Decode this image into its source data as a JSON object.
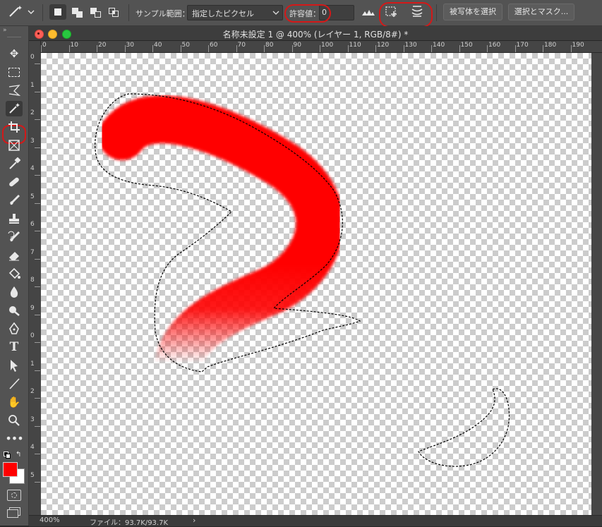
{
  "options_bar": {
    "sample_label": "サンプル範囲：",
    "sample_value": "指定したピクセル",
    "tolerance_label": "許容値：",
    "tolerance_value": "0",
    "select_subject": "被写体を選択",
    "select_and_mask": "選択とマスク..."
  },
  "document": {
    "title": "名称未設定 1 @ 400% (レイヤー 1, RGB/8#) *"
  },
  "ruler": {
    "top_ticks": [
      "0",
      "10",
      "20",
      "30",
      "40",
      "50",
      "60",
      "70",
      "80",
      "90",
      "100",
      "110",
      "120",
      "130",
      "140",
      "150",
      "160",
      "170",
      "180",
      "190"
    ],
    "left_ticks": [
      "0",
      "1",
      "2",
      "3",
      "4",
      "5",
      "6",
      "7",
      "8",
      "9",
      "0",
      "1",
      "2",
      "3",
      "4",
      "5"
    ]
  },
  "status": {
    "zoom": "400%",
    "file_info": "ファイル：93.7K/93.7K"
  },
  "colors": {
    "foreground": "#ff0000",
    "background": "#ffffff",
    "highlight": "#d41818",
    "stroke": "#ff0000"
  },
  "toolbar": {
    "tools": [
      "move-icon",
      "marquee-icon",
      "lasso-icon",
      "magic-wand-icon",
      "crop-icon",
      "frame-icon",
      "eyedropper-icon",
      "healing-icon",
      "brush-icon",
      "stamp-icon",
      "history-brush-icon",
      "eraser-icon",
      "bucket-icon",
      "blur-icon",
      "dodge-icon",
      "pen-icon",
      "type-icon",
      "path-select-icon",
      "line-icon",
      "hand-icon",
      "zoom-icon",
      "more-icon"
    ]
  }
}
